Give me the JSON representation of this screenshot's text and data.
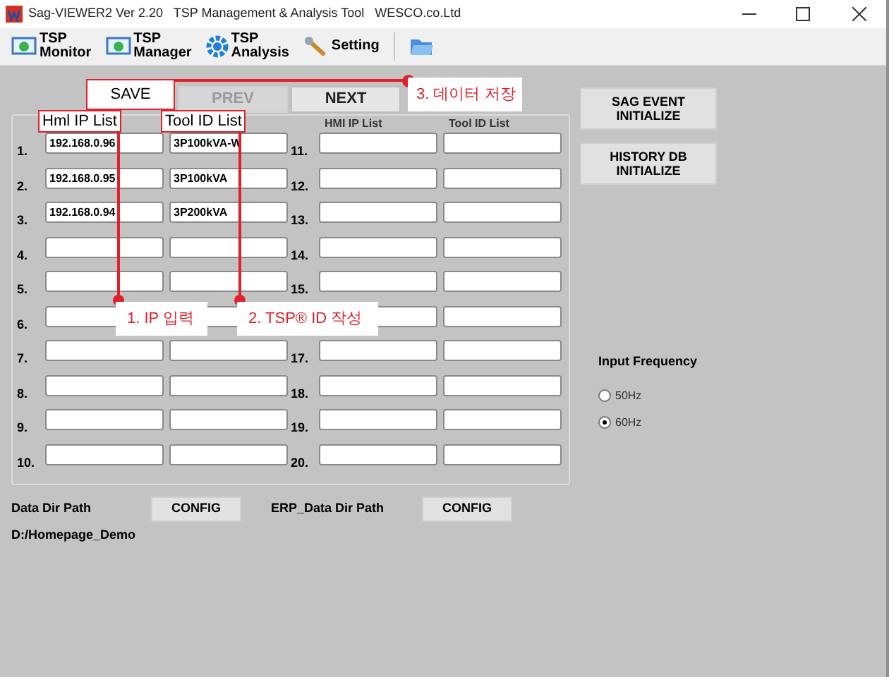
{
  "window": {
    "title": "Sag-VIEWER2 Ver 2.20   TSP Management & Analysis Tool   WESCO.co.Ltd"
  },
  "toolbar": [
    {
      "kind": "monitor",
      "lines": [
        "TSP",
        "Monitor"
      ]
    },
    {
      "kind": "manager",
      "lines": [
        "TSP",
        "Manager"
      ]
    },
    {
      "kind": "analysis",
      "lines": [
        "TSP",
        "Analysis"
      ]
    },
    {
      "kind": "setting",
      "lines": [
        "Setting"
      ]
    },
    {
      "kind": "open"
    }
  ],
  "nav_buttons": [
    {
      "label": "PREV",
      "disabled": true
    },
    {
      "label": "NEXT",
      "disabled": false
    }
  ],
  "list_headers": [
    "HMI IP List",
    "Tool ID List"
  ],
  "rows": [
    {
      "number": "1.",
      "ip": "192.168.0.96",
      "tool_id": "3P100kVA-W"
    },
    {
      "number": "2.",
      "ip": "192.168.0.95",
      "tool_id": "3P100kVA"
    },
    {
      "number": "3.",
      "ip": "192.168.0.94",
      "tool_id": "3P200kVA"
    },
    {
      "number": "4."
    },
    {
      "number": "5."
    },
    {
      "number": "6."
    },
    {
      "number": "7."
    },
    {
      "number": "8."
    },
    {
      "number": "9."
    },
    {
      "number": "10."
    },
    {
      "number": "11."
    },
    {
      "number": "12."
    },
    {
      "number": "13."
    },
    {
      "number": "14."
    },
    {
      "number": "15."
    },
    {},
    {
      "number": "17."
    },
    {
      "number": "18."
    },
    {
      "number": "19."
    },
    {
      "number": "20."
    }
  ],
  "side_buttons": [
    [
      "SAG EVENT",
      "INITIALIZE"
    ],
    [
      "HISTORY DB",
      "INITIALIZE"
    ]
  ],
  "input_frequency": {
    "label": "Input Frequency",
    "options": [
      {
        "label": "50Hz",
        "selected": false
      },
      {
        "label": "60Hz",
        "selected": true
      }
    ]
  },
  "paths": {
    "data_dir_label": "Data Dir Path",
    "data_config": "CONFIG",
    "erp_label": "ERP_Data Dir Path",
    "erp_config": "CONFIG",
    "data_dir_value": "D:/Homepage_Demo"
  },
  "annotations": {
    "save": "SAVE",
    "hmi_list": "Hml IP List",
    "tool_list": "Tool ID List",
    "callouts": [
      "1. IP 입력",
      "2. TSP® ID 작성",
      "3. 데이터 저장"
    ]
  }
}
